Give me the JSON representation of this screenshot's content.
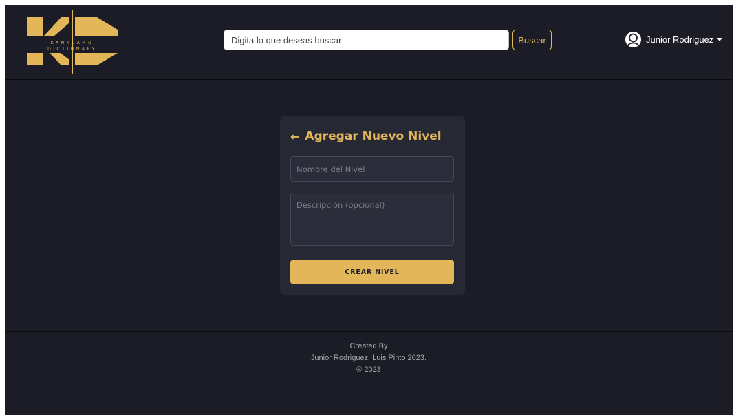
{
  "header": {
    "logo": {
      "letters": "KD",
      "line1": "KANKUAMO",
      "line2": "DICTIONARY"
    },
    "search": {
      "placeholder": "Digita lo que deseas buscar",
      "button_label": "Buscar"
    },
    "user": {
      "name": "Junior Rodriguez"
    }
  },
  "form": {
    "title": "Agregar Nuevo Nivel",
    "back_icon": "arrow-left-icon",
    "name_placeholder": "Nombre del Nivel",
    "description_placeholder": "Descripción (opcional)",
    "submit_label": "CREAR NIVEL"
  },
  "footer": {
    "line1": "Created By",
    "line2": "Junior Rodriguez, Luis Pinto 2023.",
    "line3": "® 2023"
  },
  "colors": {
    "background": "#1b1c26",
    "card": "#262833",
    "accent": "#e3b65a",
    "field": "#2b2d3a"
  }
}
